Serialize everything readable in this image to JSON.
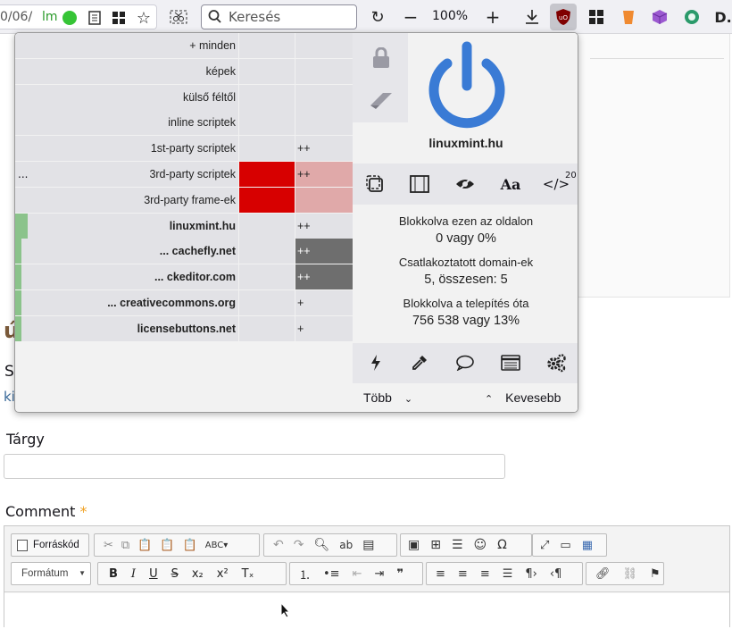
{
  "toolbar": {
    "url_fragment": "0/06/",
    "site_badge": "lm",
    "search_placeholder": "Keresés",
    "zoom": "100%"
  },
  "page": {
    "letter_u": "ú",
    "letter_s": "S",
    "letter_k": "ki",
    "subject_label": "Tárgy",
    "comment_label": "Comment",
    "required_mark": "*",
    "editor": {
      "source_label": "Forráskód",
      "format_label": "Formátum"
    }
  },
  "popup": {
    "rows": [
      {
        "label": "+ minden",
        "c2": ""
      },
      {
        "label": "képek",
        "c2": ""
      },
      {
        "label": "külső féltől",
        "c2": ""
      },
      {
        "label": "inline scriptek",
        "c2": ""
      },
      {
        "label": "1st-party scriptek",
        "c2": "++"
      },
      {
        "label": "3rd-party scriptek",
        "c2": "++",
        "prefix": "..."
      },
      {
        "label": "3rd-party frame-ek",
        "c2": ""
      },
      {
        "label": "linuxmint.hu",
        "c2": "++",
        "bold": true
      },
      {
        "label": "... cachefly.net",
        "c2": "++",
        "bold": true
      },
      {
        "label": "... ckeditor.com",
        "c2": "++",
        "bold": true
      },
      {
        "label": "... creativecommons.org",
        "c2": "+",
        "bold": true
      },
      {
        "label": "licensebuttons.net",
        "c2": "+",
        "bold": true
      }
    ],
    "hostname": "linuxmint.hu",
    "script_count": "20",
    "stats": [
      {
        "label": "Blokkolva ezen az oldalon",
        "value": "0 vagy 0%"
      },
      {
        "label": "Csatlakoztatott domain-ek",
        "value": "5, összesen: 5"
      },
      {
        "label": "Blokkolva a telepítés óta",
        "value": "756 538 vagy 13%"
      }
    ],
    "more_label": "Több",
    "less_label": "Kevesebb",
    "colors": {
      "accent": "#3a7bd5",
      "block_red": "#d70000",
      "block_pink": "#e0a9a9",
      "noop_gray": "#6e6e6e",
      "allow_green": "#8bc38b"
    }
  }
}
